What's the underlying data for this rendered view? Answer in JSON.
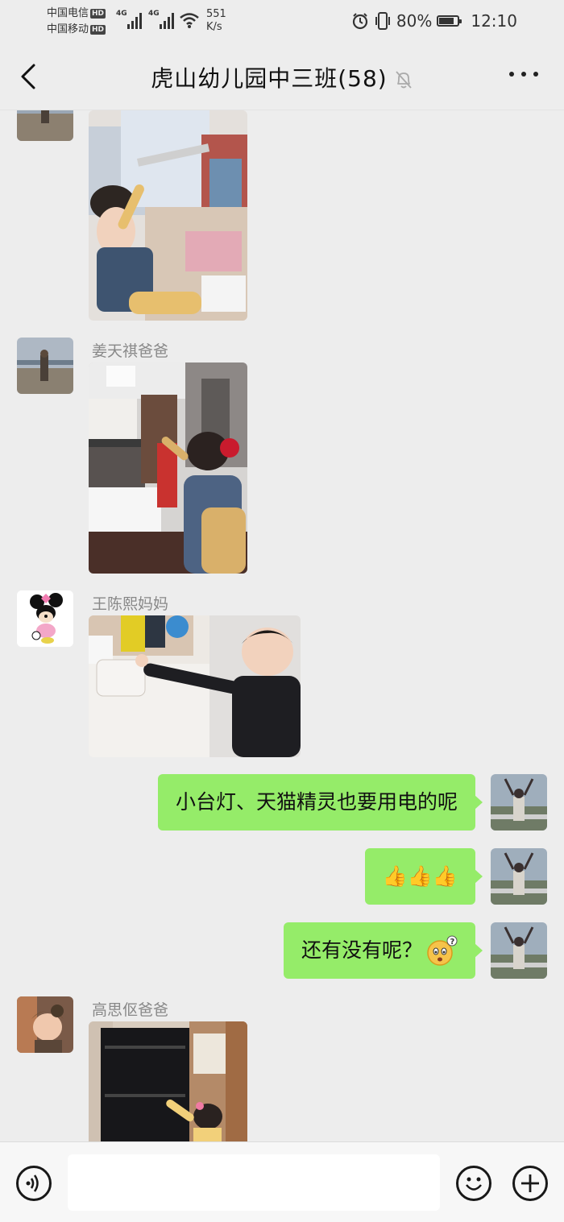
{
  "status_bar": {
    "carrier1": "中国电信",
    "carrier2": "中国移动",
    "hd_badge": "HD",
    "network1": "4G",
    "network2": "4G",
    "speed_value": "551",
    "speed_unit": "K/s",
    "battery_percent": "80%",
    "battery_level": 0.8,
    "time": "12:10"
  },
  "header": {
    "title": "虎山幼儿园中三班(58)",
    "back_icon": "chevron-left-icon",
    "mute_icon": "bell-off-icon",
    "more_icon": "more-horizontal-icon"
  },
  "messages": [
    {
      "type": "image",
      "side": "left",
      "sender": ""
    },
    {
      "type": "image",
      "side": "left",
      "sender": "姜天祺爸爸"
    },
    {
      "type": "image",
      "side": "left",
      "sender": "王陈熙妈妈"
    },
    {
      "type": "text",
      "side": "right",
      "text": "小台灯、天猫精灵也要用电的呢"
    },
    {
      "type": "text",
      "side": "right",
      "text": "👍👍👍"
    },
    {
      "type": "text",
      "side": "right",
      "text": "还有没有呢？",
      "emoji": "face-with-question-icon"
    },
    {
      "type": "image",
      "side": "left",
      "sender": "高思伛爸爸"
    }
  ],
  "input_bar": {
    "voice_icon": "voice-icon",
    "text_value": "",
    "emoji_icon": "smiley-icon",
    "plus_icon": "plus-icon"
  },
  "colors": {
    "background": "#ededed",
    "bubble_green": "#95ec69",
    "sender_gray": "#888888"
  }
}
